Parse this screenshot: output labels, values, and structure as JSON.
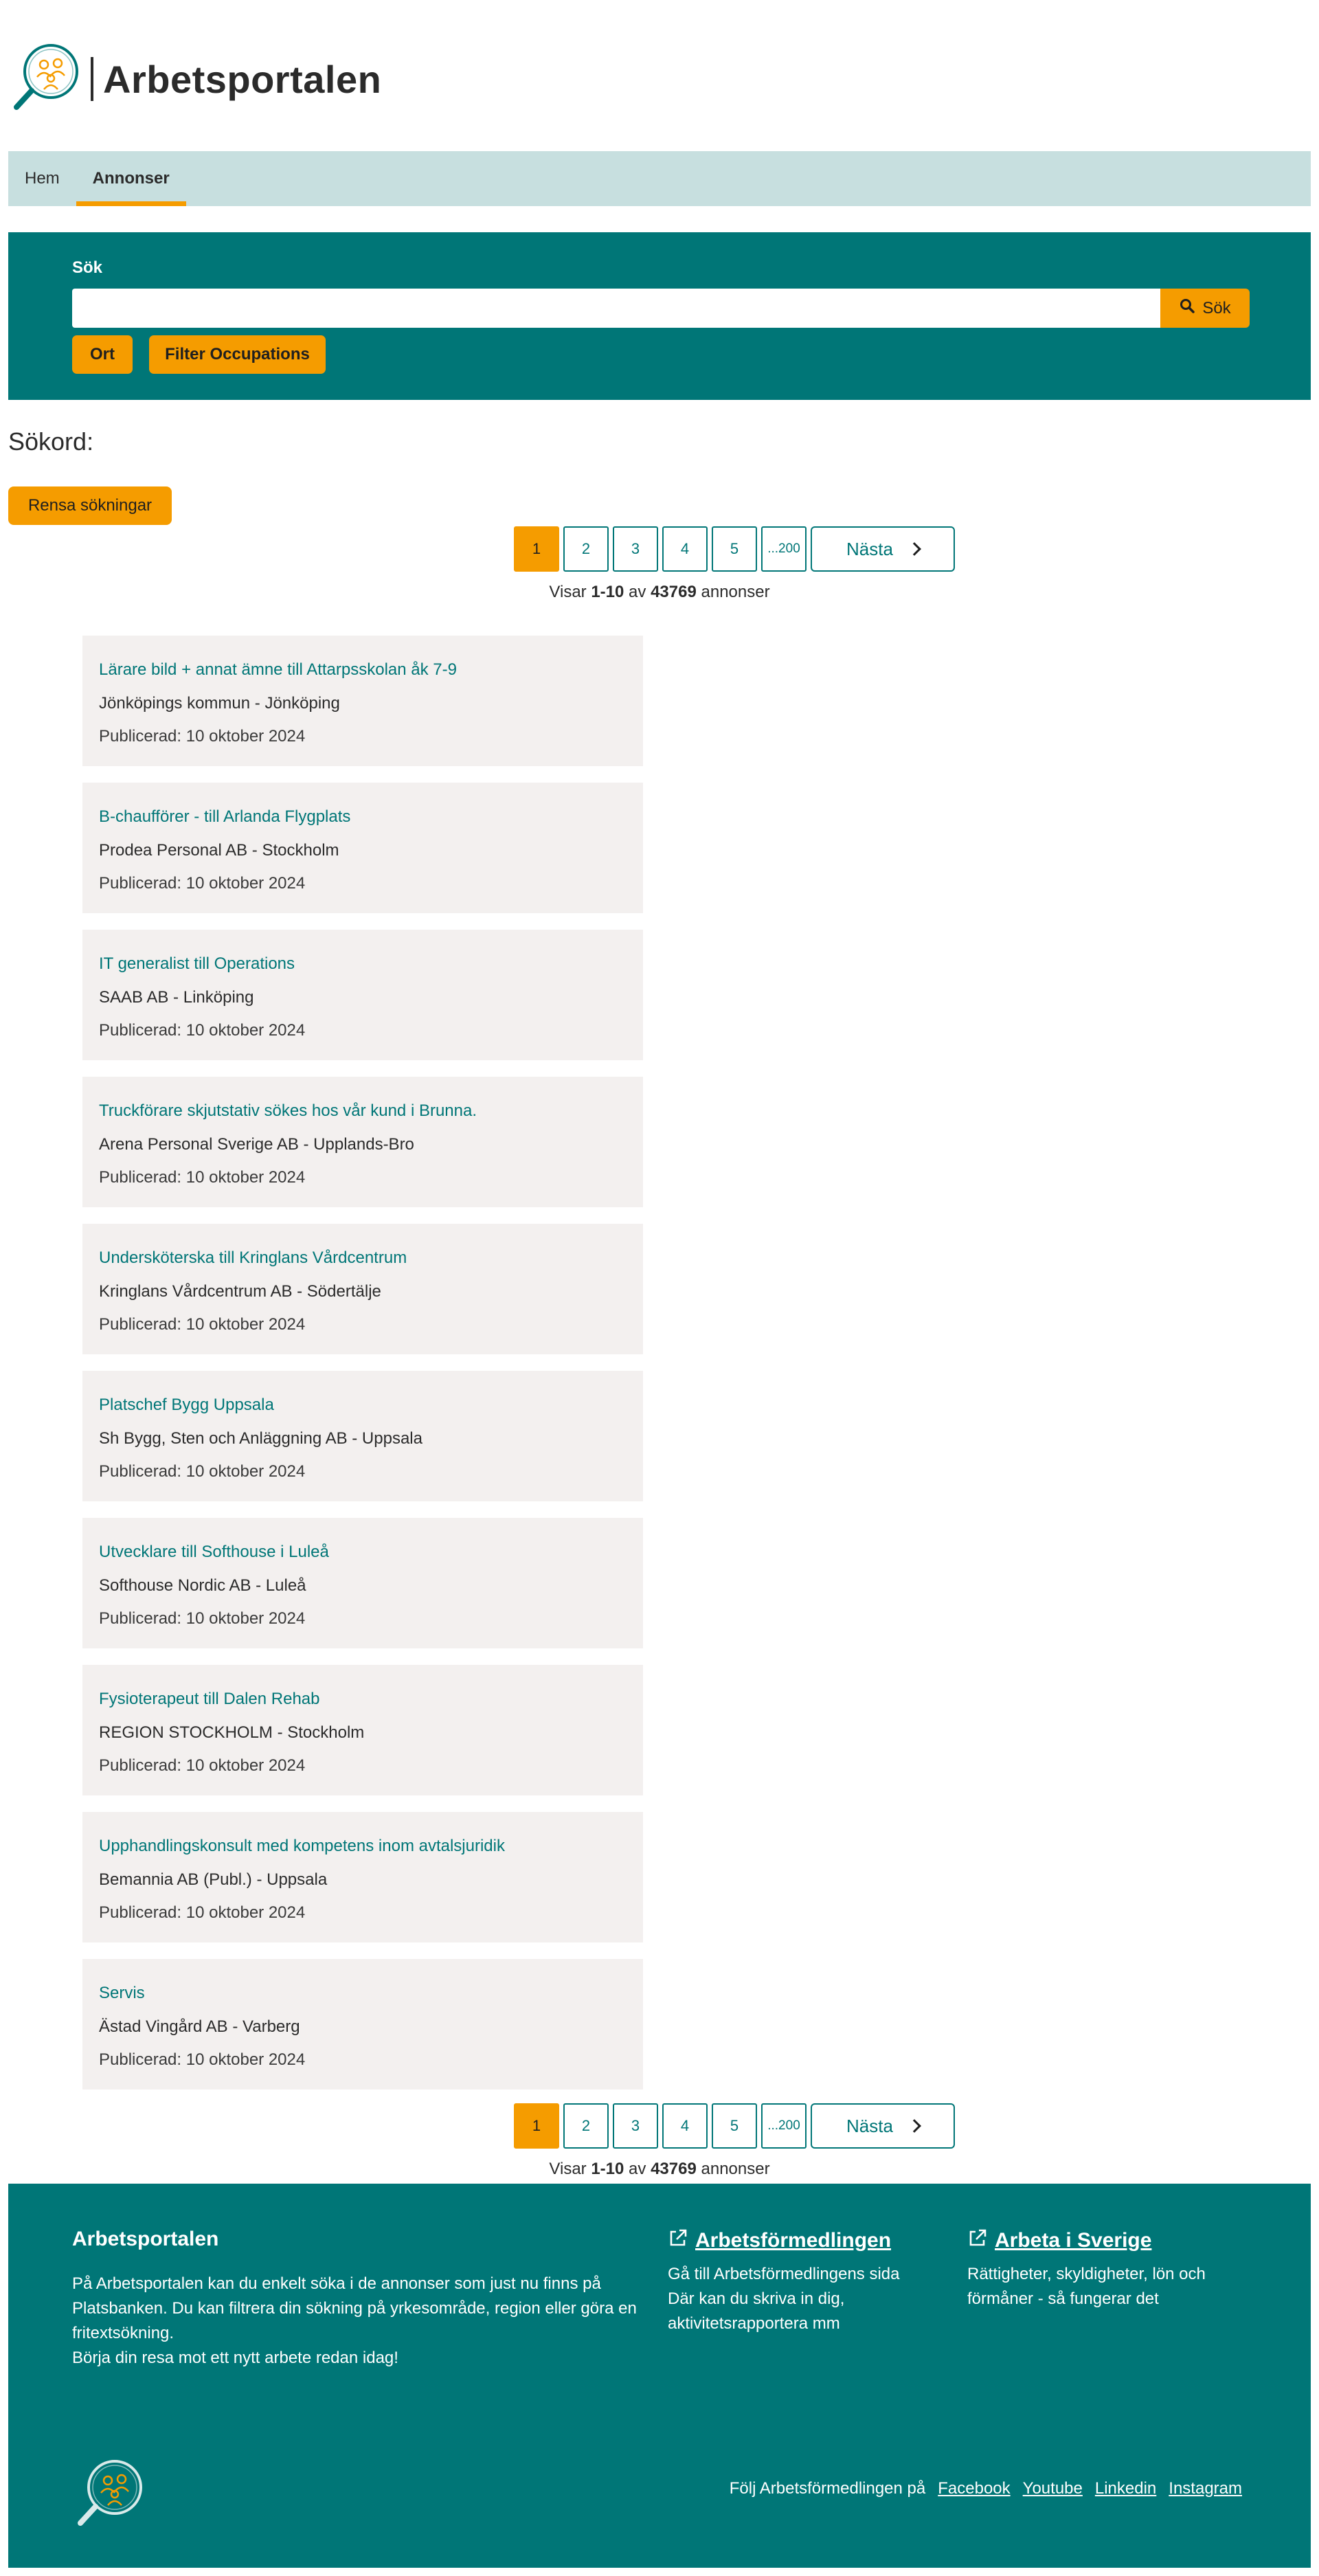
{
  "header": {
    "title": "Arbetsportalen"
  },
  "nav": {
    "items": [
      {
        "label": "Hem"
      },
      {
        "label": "Annonser"
      }
    ]
  },
  "search": {
    "label": "Sök",
    "input_value": "",
    "button_label": "Sök",
    "filters": [
      {
        "label": "Ort"
      },
      {
        "label": "Filter Occupations"
      }
    ]
  },
  "sokord": {
    "label": "Sökord:"
  },
  "clear_button": "Rensa sökningar",
  "pagination": {
    "pages": [
      "1",
      "2",
      "3",
      "4",
      "5",
      "...200"
    ],
    "current": "1",
    "next_label": "Nästa",
    "summary": {
      "prefix": "Visar",
      "range": "1-10",
      "middle": "av",
      "total": "43769",
      "suffix": "annonser"
    }
  },
  "listings": [
    {
      "title": "Lärare bild + annat ämne till Attarpsskolan åk 7-9",
      "employer": "Jönköpings kommun - Jönköping",
      "published": "Publicerad: 10 oktober 2024"
    },
    {
      "title": "B-chaufförer - till Arlanda Flygplats",
      "employer": "Prodea Personal AB - Stockholm",
      "published": "Publicerad: 10 oktober 2024"
    },
    {
      "title": "IT generalist till Operations",
      "employer": "SAAB AB - Linköping",
      "published": "Publicerad: 10 oktober 2024"
    },
    {
      "title": "Truckförare skjutstativ sökes hos vår kund i Brunna.",
      "employer": "Arena Personal Sverige AB - Upplands-Bro",
      "published": "Publicerad: 10 oktober 2024"
    },
    {
      "title": "Undersköterska till Kringlans Vårdcentrum",
      "employer": "Kringlans Vårdcentrum AB - Södertälje",
      "published": "Publicerad: 10 oktober 2024"
    },
    {
      "title": "Platschef Bygg Uppsala",
      "employer": "Sh Bygg, Sten och Anläggning AB - Uppsala",
      "published": "Publicerad: 10 oktober 2024"
    },
    {
      "title": "Utvecklare till Softhouse i Luleå",
      "employer": "Softhouse Nordic AB - Luleå",
      "published": "Publicerad: 10 oktober 2024"
    },
    {
      "title": "Fysioterapeut till Dalen Rehab",
      "employer": "REGION STOCKHOLM - Stockholm",
      "published": "Publicerad: 10 oktober 2024"
    },
    {
      "title": "Upphandlingskonsult med kompetens inom avtalsjuridik",
      "employer": "Bemannia AB (Publ.) - Uppsala",
      "published": "Publicerad: 10 oktober 2024"
    },
    {
      "title": "Servis",
      "employer": "Ästad Vingård AB - Varberg",
      "published": "Publicerad: 10 oktober 2024"
    }
  ],
  "footer": {
    "title": "Arbetsportalen",
    "text_1": "På Arbetsportalen kan du enkelt söka i de annonser som just nu finns på Platsbanken. Du kan filtrera din sökning på yrkesområde, region eller göra en fritextsökning.",
    "text_2": "Börja din resa mot ett nytt arbete redan idag!",
    "links": [
      {
        "label": "Arbetsförmedlingen",
        "desc_1": "Gå till Arbetsförmedlingens sida",
        "desc_2": "Där kan du skriva in dig, aktivitetsrapportera mm"
      },
      {
        "label": "Arbeta i Sverige",
        "desc_1": "Rättigheter, skyldigheter, lön och förmåner - så fungerar det",
        "desc_2": ""
      }
    ],
    "social_prefix": "Följ Arbetsförmedlingen på",
    "social": [
      "Facebook",
      "Youtube",
      "Linkedin",
      "Instagram"
    ]
  },
  "colors": {
    "teal": "#007677",
    "orange": "#f59c00",
    "nav_bg": "#c7dfdf",
    "card_bg": "#f3f0ef"
  },
  "icons": [
    "logo-magnifier-icon",
    "search-icon",
    "chevron-right-icon",
    "external-link-icon"
  ]
}
